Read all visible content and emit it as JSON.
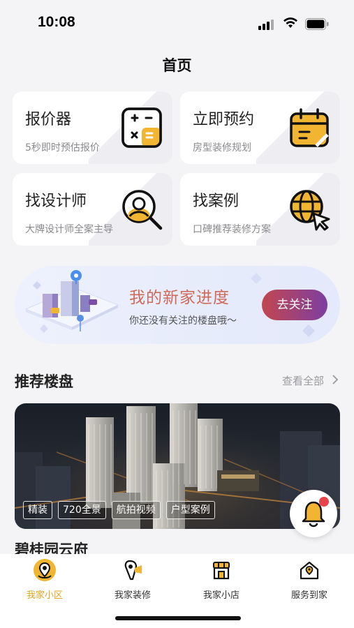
{
  "status": {
    "time": "10:08"
  },
  "page": {
    "title": "首页"
  },
  "cards": [
    {
      "title": "报价器",
      "subtitle": "5秒即时预估报价",
      "icon": "calculator-icon"
    },
    {
      "title": "立即预约",
      "subtitle": "房型装修规划",
      "icon": "calendar-icon"
    },
    {
      "title": "找设计师",
      "subtitle": "大牌设计师全案主导",
      "icon": "designer-search-icon"
    },
    {
      "title": "找案例",
      "subtitle": "口碑推荐装修方案",
      "icon": "globe-cursor-icon"
    }
  ],
  "banner": {
    "title": "我的新家进度",
    "subtitle": "你还没有关注的楼盘哦～",
    "button": "去关注"
  },
  "recommend": {
    "title": "推荐楼盘",
    "view_all": "查看全部"
  },
  "project": {
    "name": "碧桂园云府",
    "tags": [
      "精装",
      "720全景",
      "航拍视频",
      "户型案例"
    ]
  },
  "tabs": [
    {
      "label": "我家小区",
      "icon": "community-location-icon",
      "active": true
    },
    {
      "label": "我家装修",
      "icon": "renovation-icon",
      "active": false
    },
    {
      "label": "我家小店",
      "icon": "shop-icon",
      "active": false
    },
    {
      "label": "服务到家",
      "icon": "home-service-icon",
      "active": false
    }
  ],
  "colors": {
    "accent": "#e0a520",
    "icon_yellow": "#f2b531",
    "banner_title": "#cf6a5a",
    "button_start": "#c2474f",
    "button_end": "#7d3ea0"
  }
}
